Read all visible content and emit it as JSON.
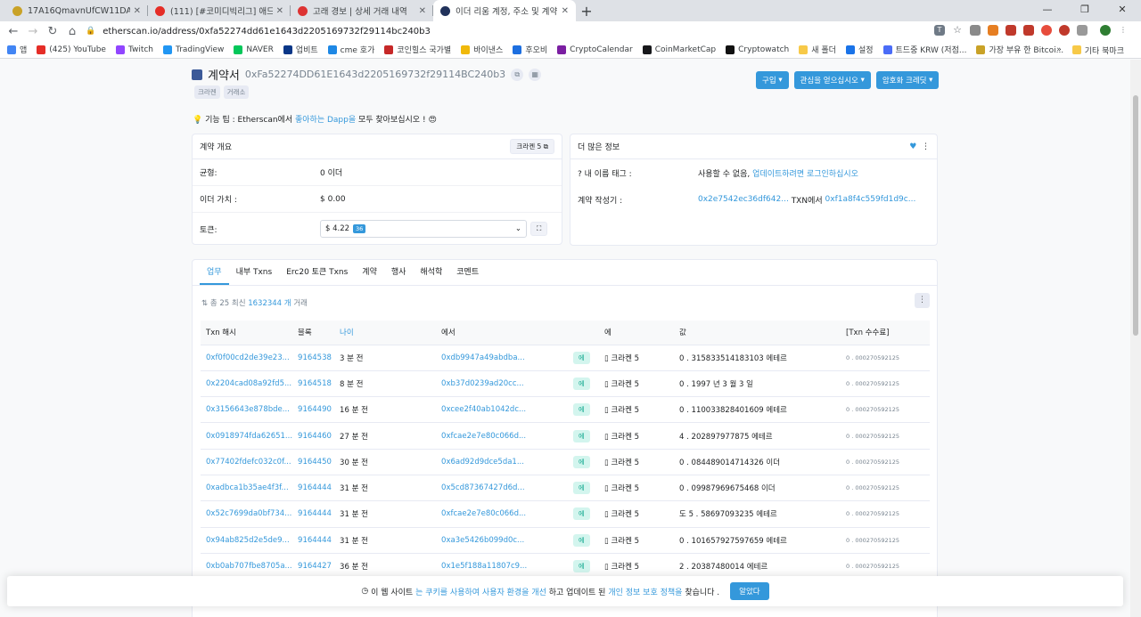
{
  "tabs": [
    {
      "title": "17A16QmavnUfCW11DAApUxpf",
      "color": "#c9a227",
      "active": false
    },
    {
      "title": "(111) [#코미디빅리그] 애드립",
      "color": "#e52d27",
      "active": false
    },
    {
      "title": "고래 경보 | 상세 거래 내역",
      "color": "#d33",
      "active": false
    },
    {
      "title": "이더 리움 계정, 주소 및 계약",
      "color": "#21325b",
      "active": true
    }
  ],
  "url": "etherscan.io/address/0xfa52274dd61e1643d2205169732f29114bc240b3",
  "bookmarks": [
    {
      "label": "앱",
      "color": "#4285f4"
    },
    {
      "label": "(425) YouTube",
      "color": "#e52d27"
    },
    {
      "label": "Twitch",
      "color": "#9146ff"
    },
    {
      "label": "TradingView",
      "color": "#2196f3"
    },
    {
      "label": "NAVER",
      "color": "#03c75a"
    },
    {
      "label": "업비트",
      "color": "#093687"
    },
    {
      "label": "cme 호가",
      "color": "#1e88e5"
    },
    {
      "label": "코인힐스 국가별",
      "color": "#c62828"
    },
    {
      "label": "바이낸스",
      "color": "#f0b90b"
    },
    {
      "label": "후오비",
      "color": "#1d6fe0"
    },
    {
      "label": "CryptoCalendar",
      "color": "#7b1fa2"
    },
    {
      "label": "CoinMarketCap",
      "color": "#17181b"
    },
    {
      "label": "Cryptowatch",
      "color": "#111"
    },
    {
      "label": "새 폴더",
      "color": "#f7c948"
    },
    {
      "label": "설정",
      "color": "#1a73e8"
    },
    {
      "label": "트드중 KRW (저점...",
      "color": "#4a6cf7"
    },
    {
      "label": "가장 부유 한 Bitcoi...",
      "color": "#c9a227"
    }
  ],
  "other_bookmarks": "기타 북마크",
  "header": {
    "title": "계약서",
    "address": "0xFa52274DD61E1643d2205169732f29114BC240b3",
    "tags": [
      "크라켄",
      "거래소"
    ],
    "buttons": [
      "구입",
      "관심을 얻으십시오",
      "암호화 크레딧"
    ]
  },
  "tip": {
    "prefix": "기능 팁 : Etherscan에서 ",
    "link": "좋아하는 Dapp을",
    "suffix": " 모두 찾아보십시오 !"
  },
  "overview": {
    "title": "계약 개요",
    "badge": "크라켄 5",
    "balance_label": "균형:",
    "balance": "0 이더",
    "value_label": "이더 가치 :",
    "value": "$ 0.00",
    "token_label": "토큰:",
    "token_value": "$ 4.22",
    "token_count": "36"
  },
  "more": {
    "title": "더 많은 정보",
    "name_tag_label": "내 이름 태그 :",
    "name_tag_value": "사용할 수 없음,",
    "name_tag_link": "업데이트하려면 로그인하십시오",
    "creator_label": "계약 작성기 :",
    "creator": "0x2e7542ec36df642...",
    "creator_mid": "TXN에서",
    "creator_tx": "0xf1a8f4c559fd1d9c..."
  },
  "txtabs": [
    "업무",
    "내부 Txns",
    "Erc20 토큰 Txns",
    "계약",
    "행사",
    "해석학",
    "코멘트"
  ],
  "summary": {
    "prefix": "총 25 최신",
    "count": "1632344 개",
    "suffix": "거래"
  },
  "columns": [
    "Txn 해시",
    "블록",
    "나이",
    "에서",
    "",
    "에",
    "값",
    "[Txn 수수료]"
  ],
  "rows": [
    {
      "hash": "0xf0f00cd2de39e23...",
      "block": "9164538",
      "age": "3 분 전",
      "from": "0xdb9947a49abdba...",
      "dir": "에",
      "to": "크라켄 5",
      "value": "0 . 315833514183103 에테르",
      "fee": "0 . 000270592125"
    },
    {
      "hash": "0x2204cad08a92fd5...",
      "block": "9164518",
      "age": "8 분 전",
      "from": "0xb37d0239ad20cc...",
      "dir": "에",
      "to": "크라켄 5",
      "value": "0 . 1997 년 3 월 3 일",
      "fee": "0 . 000270592125"
    },
    {
      "hash": "0x3156643e878bde...",
      "block": "9164490",
      "age": "16 분 전",
      "from": "0xcee2f40ab1042dc...",
      "dir": "에",
      "to": "크라켄 5",
      "value": "0 . 110033828401609 에테르",
      "fee": "0 . 000270592125"
    },
    {
      "hash": "0x0918974fda62651...",
      "block": "9164460",
      "age": "27 분 전",
      "from": "0xfcae2e7e80c066d...",
      "dir": "에",
      "to": "크라켄 5",
      "value": "4 . 202897977875 에테르",
      "fee": "0 . 000270592125"
    },
    {
      "hash": "0x77402fdefc032c0f...",
      "block": "9164450",
      "age": "30 분 전",
      "from": "0x6ad92d9dce5da1...",
      "dir": "에",
      "to": "크라켄 5",
      "value": "0 . 084489014714326 이더",
      "fee": "0 . 000270592125"
    },
    {
      "hash": "0xadbca1b35ae4f3f...",
      "block": "9164444",
      "age": "31 분 전",
      "from": "0x5cd87367427d6d...",
      "dir": "에",
      "to": "크라켄 5",
      "value": "0 . 09987969675468 이더",
      "fee": "0 . 000270592125"
    },
    {
      "hash": "0x52c7699da0bf734...",
      "block": "9164444",
      "age": "31 분 전",
      "from": "0xfcae2e7e80c066d...",
      "dir": "에",
      "to": "크라켄 5",
      "value": "도 5 . 58697093235 에테르",
      "fee": "0 . 000270592125"
    },
    {
      "hash": "0x94ab825d2e5de9...",
      "block": "9164444",
      "age": "31 분 전",
      "from": "0xa3e5426b099d0c...",
      "dir": "에",
      "to": "크라켄 5",
      "value": "0 . 101657927597659 에테르",
      "fee": "0 . 000270592125"
    },
    {
      "hash": "0xb0ab707fbe8705a...",
      "block": "9164427",
      "age": "36 분 전",
      "from": "0x1e5f188a11807c9...",
      "dir": "에",
      "to": "크라켄 5",
      "value": "2 . 20387480014 에테르",
      "fee": "0 . 000270592125"
    }
  ],
  "cookie": {
    "p1": "이 웹 사이트",
    "l1": "는 쿠키를 사용하여 사용자 환경을 개선",
    "p2": "하고 업데이트 된",
    "l2": "개인 정보 보호 정책을",
    "p3": "찾습니다 .",
    "button": "알았다"
  }
}
